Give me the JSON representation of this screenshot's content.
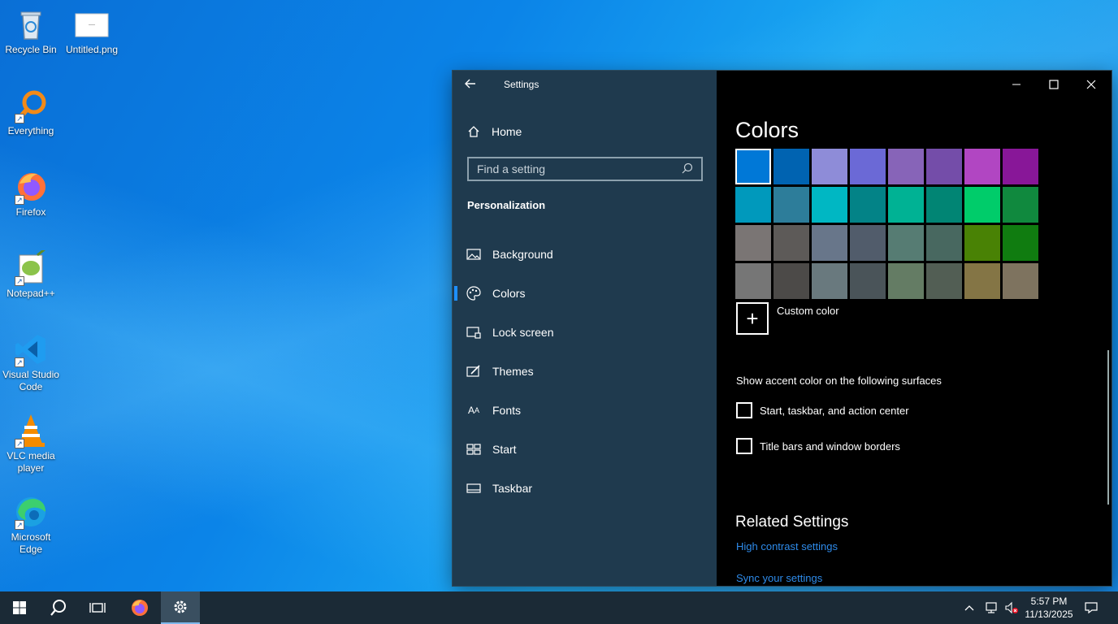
{
  "desktop": {
    "icons": [
      {
        "label": "Recycle Bin",
        "icon": "recycle-bin-icon"
      },
      {
        "label": "Untitled.png",
        "icon": "image-file-icon"
      },
      {
        "label": "Everything",
        "icon": "everything-search-icon"
      },
      {
        "label": "Firefox",
        "icon": "firefox-icon"
      },
      {
        "label": "Notepad++",
        "icon": "notepadpp-icon"
      },
      {
        "label": "Visual Studio Code",
        "icon": "vscode-icon"
      },
      {
        "label": "VLC media player",
        "icon": "vlc-icon"
      },
      {
        "label": "Microsoft Edge",
        "icon": "edge-icon"
      }
    ]
  },
  "window": {
    "title": "Settings",
    "home_label": "Home",
    "search_placeholder": "Find a setting",
    "section_title": "Personalization",
    "nav": [
      {
        "label": "Background",
        "icon": "picture-icon"
      },
      {
        "label": "Colors",
        "icon": "palette-icon",
        "active": true
      },
      {
        "label": "Lock screen",
        "icon": "lock-screen-icon"
      },
      {
        "label": "Themes",
        "icon": "themes-icon"
      },
      {
        "label": "Fonts",
        "icon": "fonts-icon"
      },
      {
        "label": "Start",
        "icon": "start-icon"
      },
      {
        "label": "Taskbar",
        "icon": "taskbar-icon"
      }
    ]
  },
  "content": {
    "title": "Colors",
    "swatches": [
      "#0078d7",
      "#0063b1",
      "#8e8cd8",
      "#6b69d6",
      "#8764b8",
      "#744da9",
      "#b146c2",
      "#881798",
      "#0099bc",
      "#2d7d9a",
      "#00b7c3",
      "#038387",
      "#00b294",
      "#018574",
      "#00cc6a",
      "#10893e",
      "#7a7574",
      "#5d5a58",
      "#68768a",
      "#515c6b",
      "#567c73",
      "#486860",
      "#498205",
      "#107c10",
      "#767676",
      "#4c4a48",
      "#69797e",
      "#4a5459",
      "#647c64",
      "#525e54",
      "#847545",
      "#7e735f"
    ],
    "selected_swatch": 0,
    "custom_color_label": "Custom color",
    "surfaces_heading": "Show accent color on the following surfaces",
    "checkbox_start": "Start, taskbar, and action center",
    "checkbox_titlebars": "Title bars and window borders",
    "related_heading": "Related Settings",
    "link_high_contrast": "High contrast settings",
    "link_sync": "Sync your settings"
  },
  "taskbar": {
    "time": "5:57 PM",
    "date": "11/13/2025"
  }
}
